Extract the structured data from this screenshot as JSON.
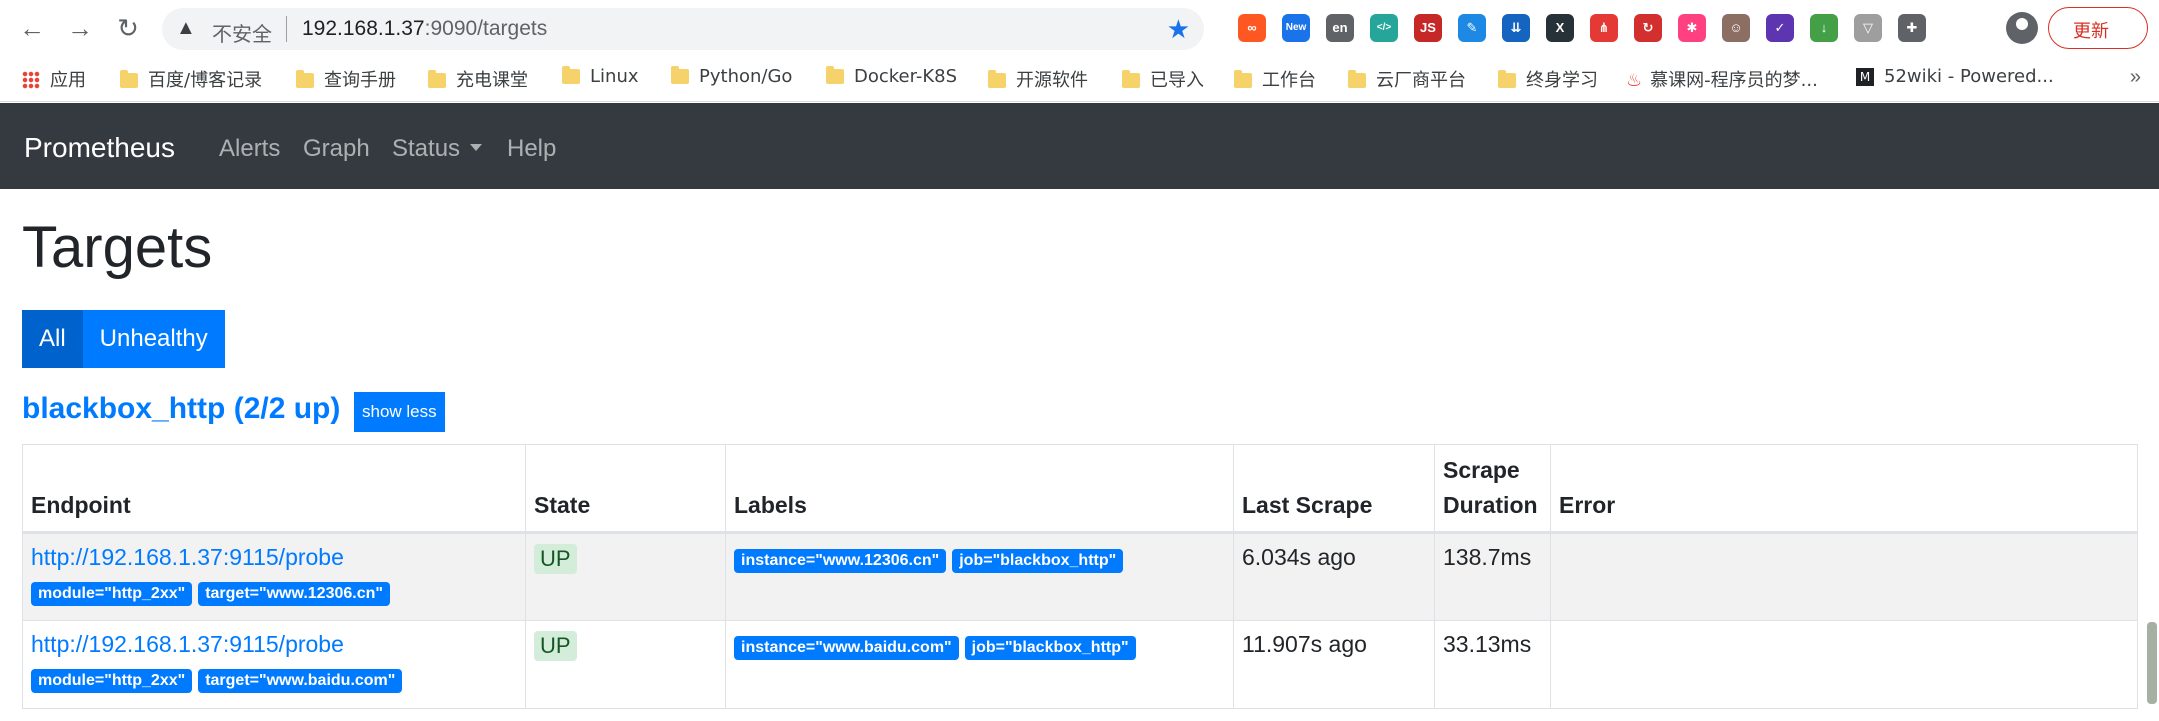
{
  "browser": {
    "insecure_label": "不安全",
    "url_host": "192.168.1.37",
    "url_path": ":9090/targets",
    "update_label": "更新",
    "extensions": [
      {
        "name": "infinity-icon",
        "color": "#ff5722",
        "glyph": "∞"
      },
      {
        "name": "new-badge-icon",
        "color": "#1a73e8",
        "glyph": "New"
      },
      {
        "name": "translate-icon",
        "color": "#5f6368",
        "glyph": "en"
      },
      {
        "name": "code-icon",
        "color": "#26a69a",
        "glyph": "</>"
      },
      {
        "name": "js-icon",
        "color": "#c62828",
        "glyph": "JS"
      },
      {
        "name": "feather-icon",
        "color": "#1e88e5",
        "glyph": "✎"
      },
      {
        "name": "download-icon",
        "color": "#1565c0",
        "glyph": "⇊"
      },
      {
        "name": "x-icon",
        "color": "#263238",
        "glyph": "X"
      },
      {
        "name": "sitemap-icon",
        "color": "#e53935",
        "glyph": "⋔"
      },
      {
        "name": "refresh-icon",
        "color": "#d32f2f",
        "glyph": "↻"
      },
      {
        "name": "pinwheel-icon",
        "color": "#ff4081",
        "glyph": "✱"
      },
      {
        "name": "face-icon",
        "color": "#8d6e63",
        "glyph": "☺"
      },
      {
        "name": "check-icon",
        "color": "#5e35b1",
        "glyph": "✓"
      },
      {
        "name": "save-icon",
        "color": "#43a047",
        "glyph": "↓"
      },
      {
        "name": "vue-icon",
        "color": "#9e9e9e",
        "glyph": "▽"
      },
      {
        "name": "puzzle-icon",
        "color": "#5f6368",
        "glyph": "✚"
      }
    ]
  },
  "bookmarks": {
    "apps": "应用",
    "items": [
      "百度/博客记录",
      "查询手册",
      "充电课堂",
      "Linux",
      "Python/Go",
      "Docker-K8S",
      "开源软件",
      "已导入",
      "工作台",
      "云厂商平台",
      "终身学习"
    ],
    "imooc": "慕课网-程序员的梦...",
    "wiki": "52wiki - Powered...",
    "overflow": "»"
  },
  "navbar": {
    "brand": "Prometheus",
    "links": [
      "Alerts",
      "Graph",
      "Status",
      "Help"
    ]
  },
  "page": {
    "title": "Targets",
    "filter_all": "All",
    "filter_unhealthy": "Unhealthy"
  },
  "pool": {
    "heading": "blackbox_http (2/2 up)",
    "toggle_label": "show less",
    "columns": [
      "Endpoint",
      "State",
      "Labels",
      "Last Scrape",
      "Scrape Duration",
      "Error"
    ],
    "rows": [
      {
        "endpoint": "http://192.168.1.37:9115/probe",
        "params": [
          "module=\"http_2xx\"",
          "target=\"www.12306.cn\""
        ],
        "state": "UP",
        "labels": [
          "instance=\"www.12306.cn\"",
          "job=\"blackbox_http\""
        ],
        "last_scrape": "6.034s ago",
        "duration": "138.7ms",
        "error": ""
      },
      {
        "endpoint": "http://192.168.1.37:9115/probe",
        "params": [
          "module=\"http_2xx\"",
          "target=\"www.baidu.com\""
        ],
        "state": "UP",
        "labels": [
          "instance=\"www.baidu.com\"",
          "job=\"blackbox_http\""
        ],
        "last_scrape": "11.907s ago",
        "duration": "33.13ms",
        "error": ""
      }
    ]
  }
}
